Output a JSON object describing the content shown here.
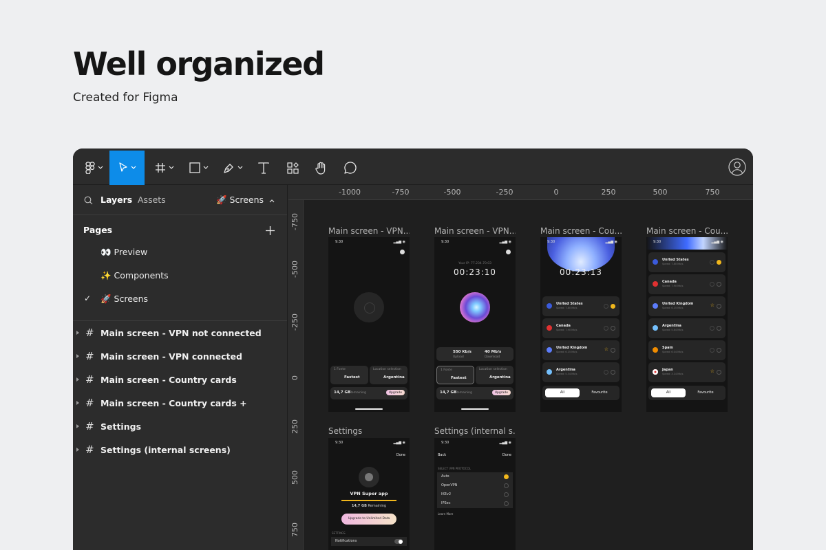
{
  "hero": {
    "title": "Well organized",
    "subtitle": "Created for Figma"
  },
  "left_panel": {
    "tab_layers": "Layers",
    "tab_assets": "Assets",
    "current_page": "🚀 Screens",
    "pages_title": "Pages",
    "pages": [
      "👀 Preview",
      "✨ Components",
      "🚀 Screens"
    ],
    "frames": [
      "Main screen - VPN not connected",
      "Main screen - VPN connected",
      "Main screen - Country cards",
      "Main screen - Country cards +",
      "Settings",
      "Settings (internal screens)"
    ]
  },
  "rulers": {
    "top": [
      "-1000",
      "-750",
      "-500",
      "-250",
      "0",
      "250",
      "500",
      "750"
    ],
    "left": [
      "-750",
      "-500",
      "-250",
      "0",
      "250",
      "500",
      "750"
    ]
  },
  "canvas": {
    "frame_labels": [
      "Main screen - VPN...",
      "Main screen - VPN...",
      "Main screen - Cou...",
      "Main screen - Cou...",
      "Settings",
      "Settings (internal s..."
    ],
    "phone": {
      "status_time": "9:30",
      "ip": "Your IP: 77.234.70.03",
      "timer1": "00:23:10",
      "timer2": "00:23:13",
      "upload": "550 Kb/s",
      "upload_label": "Upload",
      "download": "40 Mb/s",
      "download_label": "Download",
      "mode_label": "1 Fonte",
      "mode_value": "Fastest",
      "location_label": "Location selection",
      "location_value": "Argentina",
      "data": "14,7 GB",
      "remaining": "Remaining",
      "upgrade": "Upgrade",
      "tab_all": "All",
      "tab_fav": "Favourite",
      "countries_a": [
        {
          "name": "United States",
          "speed": "Speed: 7.80 Mb/s",
          "color": "#3b5bdb"
        },
        {
          "name": "Canada",
          "speed": "Speed: 7.90 Mb/s",
          "color": "#e03131"
        },
        {
          "name": "United Kingdom",
          "speed": "Speed: 6.15 Mb/s",
          "color": "#5c7cfa"
        },
        {
          "name": "Argentina",
          "speed": "Speed: 5.34 Mb/s",
          "color": "#74c0fc"
        }
      ],
      "countries_b": [
        {
          "name": "United States",
          "speed": "Speed: 7.80 Mb/s",
          "color": "#3b5bdb"
        },
        {
          "name": "Canada",
          "speed": "Speed: 7.90 Mb/s",
          "color": "#e03131"
        },
        {
          "name": "United Kingdom",
          "speed": "Speed: 6.15 Mb/s",
          "color": "#5c7cfa"
        },
        {
          "name": "Argentina",
          "speed": "Speed: 5.84 Mb/s",
          "color": "#74c0fc"
        },
        {
          "name": "Spain",
          "speed": "Speed: 6.04 Mb/s",
          "color": "#f08c00"
        },
        {
          "name": "Japan",
          "speed": "Speed: 3.14 Mb/s",
          "color": "#ffffff"
        }
      ],
      "settings_done": "Done",
      "settings_back": "Back",
      "app_name": "VPN Super app",
      "upgrade_unlimited": "Upgrade to Unlimited Data",
      "settings_section": "SETTINGS",
      "notifications": "Notifications",
      "protocol_section": "SELECT VPN PROTOCOL",
      "protocols": [
        "Auto",
        "OpenVPN",
        "IKEv2",
        "IPSec"
      ],
      "learn_more": "Learn More"
    }
  }
}
